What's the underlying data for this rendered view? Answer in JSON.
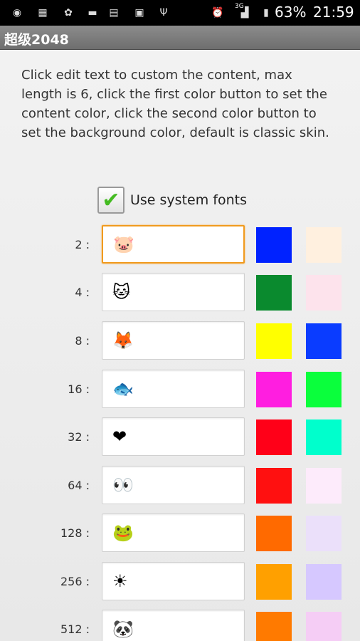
{
  "status_bar": {
    "battery": "63%",
    "time": "21:59",
    "signal_label": "3G",
    "icons": [
      "app-icon-1",
      "app-icon-2",
      "notification-icon",
      "car-icon",
      "chart-icon",
      "chat-icon",
      "usb-icon",
      "alarm-icon",
      "signal-icon",
      "battery-icon"
    ]
  },
  "title_bar": {
    "title": "超级2048"
  },
  "instructions": "Click edit text to custom the content, max length is 6, click the first color button to set the content color, click the second color button to set the background color, default is classic skin.",
  "system_fonts": {
    "label": "Use system fonts",
    "checked": true
  },
  "rows": [
    {
      "label": "2 :",
      "value": "🐷",
      "text_color": "#0022ff",
      "bg_color": "#fff0df"
    },
    {
      "label": "4 :",
      "value": "🐱",
      "text_color": "#0a8a2e",
      "bg_color": "#fde3ec"
    },
    {
      "label": "8 :",
      "value": "🦊",
      "text_color": "#ffff00",
      "bg_color": "#0a3cff"
    },
    {
      "label": "16 :",
      "value": "🐟",
      "text_color": "#ff1ee0",
      "bg_color": "#0aff3c"
    },
    {
      "label": "32 :",
      "value": "❤",
      "text_color": "#ff0018",
      "bg_color": "#00ffcc"
    },
    {
      "label": "64 :",
      "value": "👀",
      "text_color": "#ff1010",
      "bg_color": "#fdebfb"
    },
    {
      "label": "128 :",
      "value": "🐸",
      "text_color": "#ff6a00",
      "bg_color": "#ebe0fa"
    },
    {
      "label": "256 :",
      "value": "☀",
      "text_color": "#ffa000",
      "bg_color": "#d6c8ff"
    },
    {
      "label": "512 :",
      "value": "🐼",
      "text_color": "#ff7a00",
      "bg_color": "#f5cdf5"
    }
  ]
}
